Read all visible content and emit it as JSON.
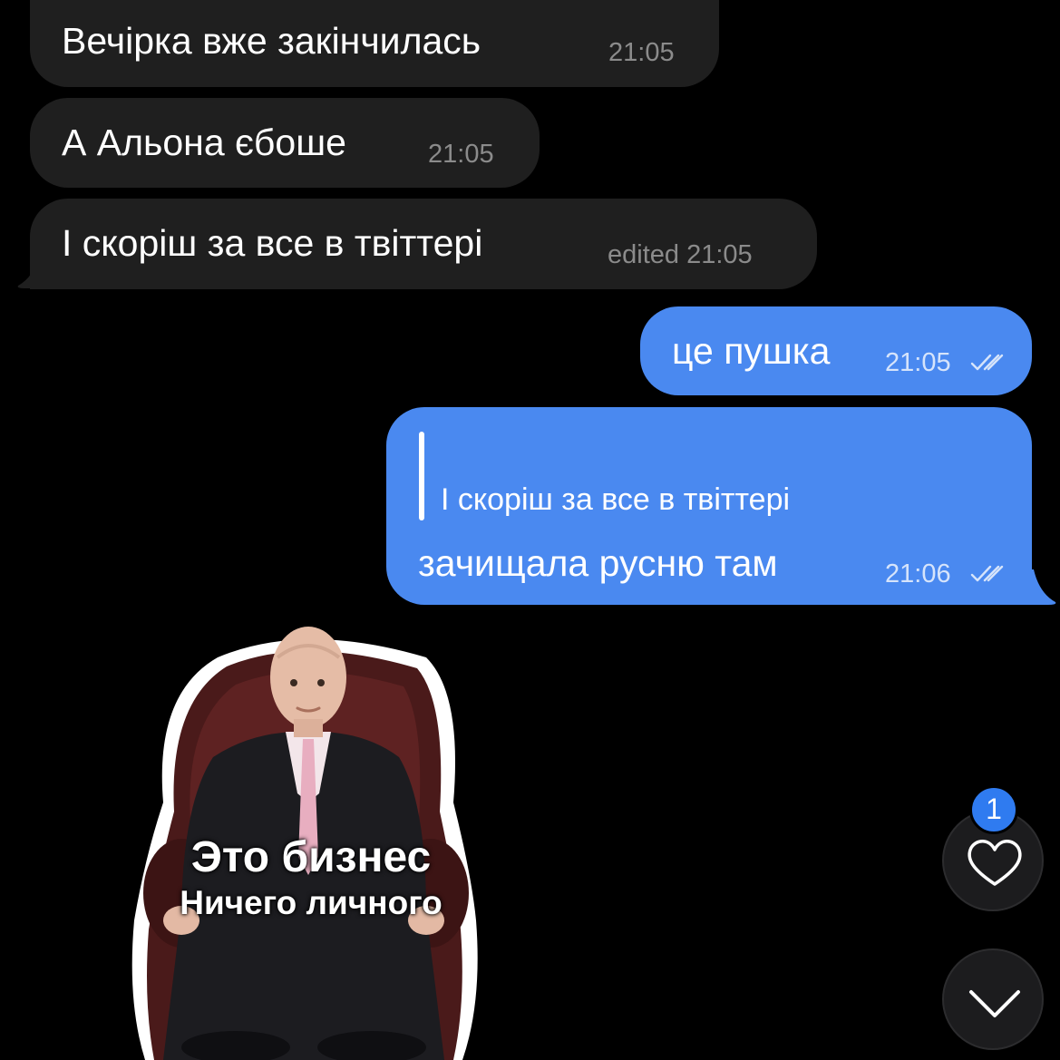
{
  "messages": {
    "m1": {
      "text": "Вечірка вже закінчилась",
      "time": "21:05"
    },
    "m2": {
      "text": "А Альона єбоше",
      "time": "21:05"
    },
    "m3": {
      "text": "І скоріш за все в твіттері",
      "time": "edited 21:05"
    },
    "m4": {
      "text": "це пушка",
      "time": "21:05"
    },
    "m5": {
      "reply_quote": "І скоріш за все в твіттері",
      "text": "зачищала русню там",
      "time": "21:06"
    }
  },
  "sticker": {
    "line1": "Это бизнес",
    "line2": "Ничего личного"
  },
  "reactions": {
    "heart_icon": "heart-icon",
    "badge_count": "1"
  },
  "scroll_down_icon": "chevron-down-icon",
  "colors": {
    "background": "#000000",
    "incoming_bubble": "#1f1f1f",
    "outgoing_bubble": "#4a89f0",
    "badge": "#2f7bf0"
  }
}
